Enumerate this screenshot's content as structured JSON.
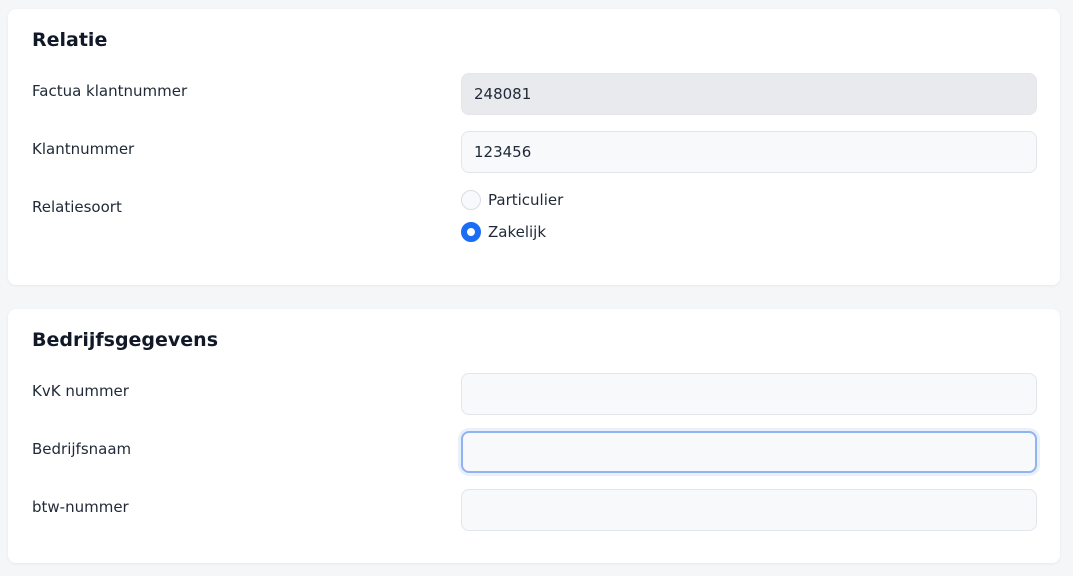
{
  "relatie": {
    "title": "Relatie",
    "factuur_klantnummer": {
      "label": "Factua klantnummer",
      "value": "248081"
    },
    "klantnummer": {
      "label": "Klantnummer",
      "value": "123456"
    },
    "relatiesoort": {
      "label": "Relatiesoort",
      "options": [
        {
          "label": "Particulier",
          "checked": false
        },
        {
          "label": "Zakelijk",
          "checked": true
        }
      ]
    }
  },
  "bedrijfsgegevens": {
    "title": "Bedrijfsgegevens",
    "kvk_nummer": {
      "label": "KvK nummer",
      "value": ""
    },
    "bedrijfsnaam": {
      "label": "Bedrijfsnaam",
      "value": ""
    },
    "btw_nummer": {
      "label": "btw-nummer",
      "value": ""
    }
  },
  "colors": {
    "accent": "#1a6ef5",
    "focus_border": "#8fb4f0",
    "readonly_bg": "#e8eaed",
    "field_bg": "#f8f9fa"
  }
}
